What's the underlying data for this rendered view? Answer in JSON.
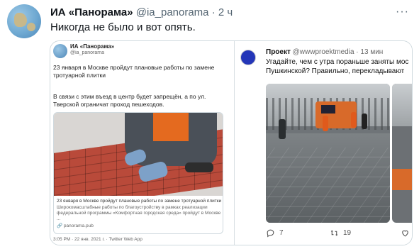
{
  "tweet": {
    "author_name": "ИА «Панорама»",
    "handle": "@ia_panorama",
    "separator": "·",
    "time": "2 ч",
    "text": "Никогда не было и вот опять.",
    "more_label": "···"
  },
  "left_screenshot": {
    "author_name": "ИА «Панорама»",
    "handle": "@ia_panorama",
    "text1": "23 января в Москве пройдут плановые работы по замене тротуарной плитки",
    "text2": "В связи с этим въезд в центр будет запрещён, а по ул. Тверской ограничат проход пешеходов.",
    "card": {
      "title": "23 января в Москве пройдут плановые работы по замене тротуарной плитки",
      "description": "Широкомасштабные работы по благоустройству в рамках реализации федеральной программы «Комфортная городская среда» пройдут в Москве ...",
      "domain": "panorama.pub"
    },
    "footer": "3:05 PM · 22 янв. 2021 г. · Twitter Web App"
  },
  "right_screenshot": {
    "author_name": "Проект",
    "handle": "@wwwproektmedia",
    "separator": "·",
    "time": "13 мин",
    "text_line1": "Угадайте, чем с утра пораньше заняты мос",
    "text_line2": "Пушкинской? Правильно, перекладывают",
    "reply_count": "7",
    "retweet_count": "19"
  }
}
